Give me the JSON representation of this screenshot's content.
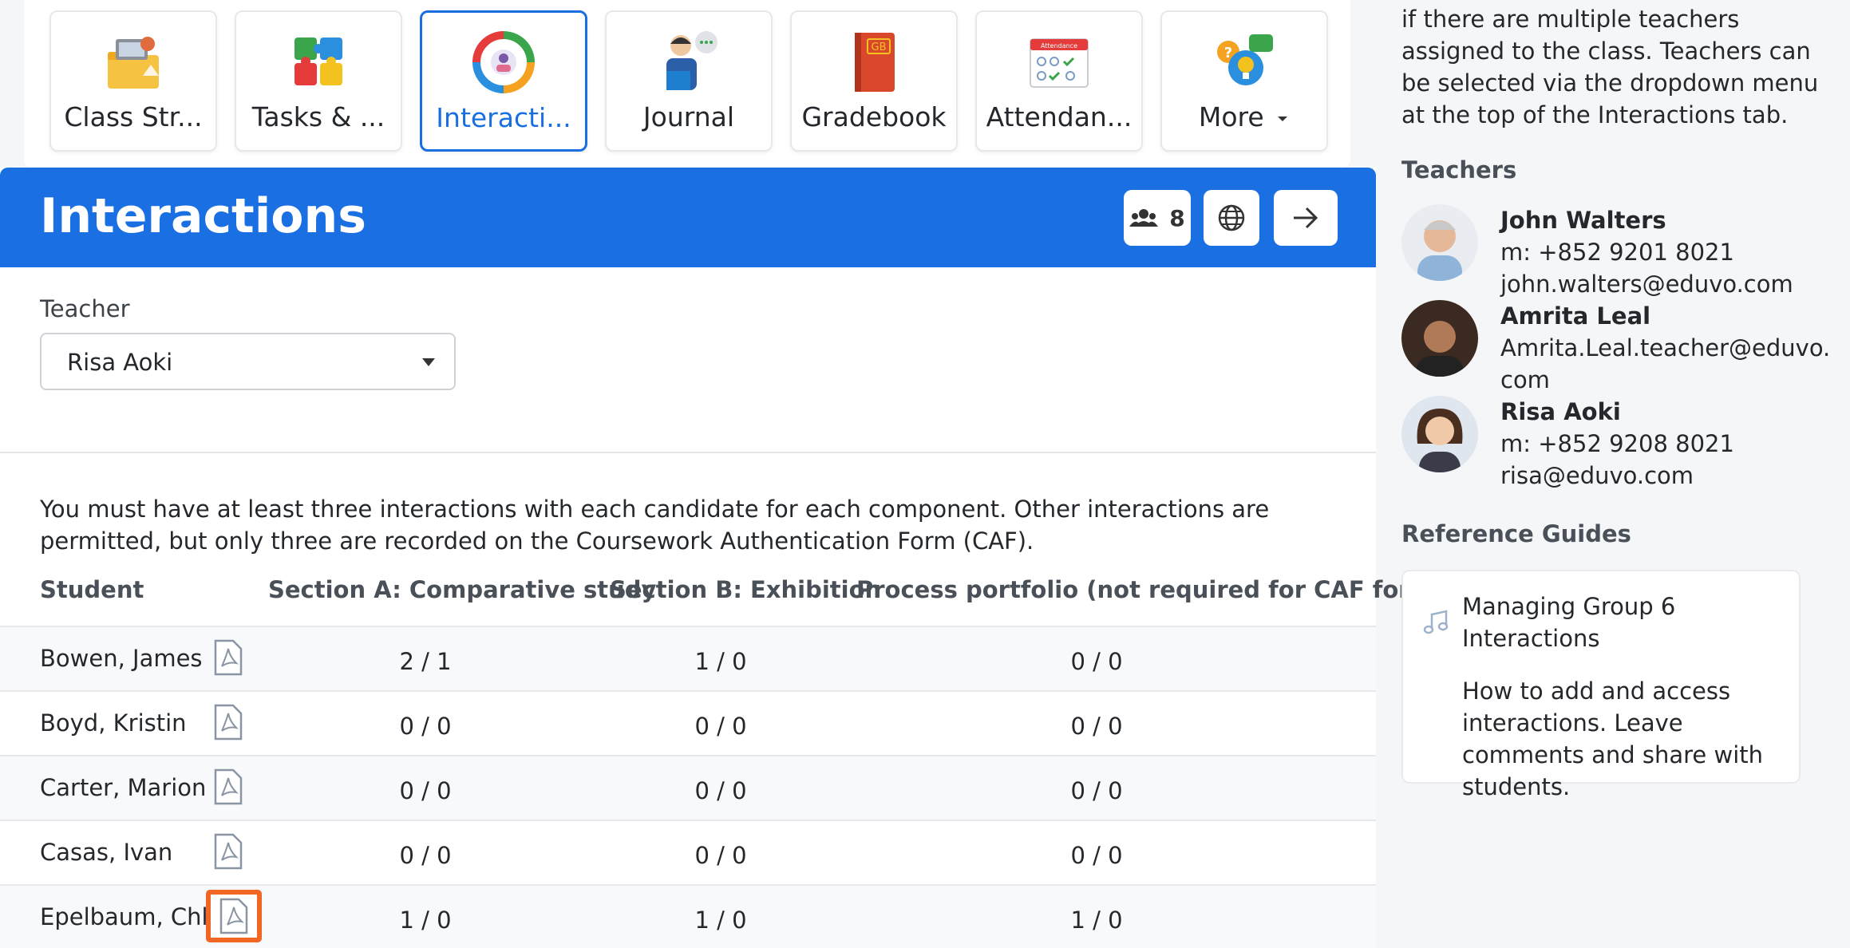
{
  "tools": [
    {
      "label": "Class Str...",
      "icon": "class-structure-icon"
    },
    {
      "label": "Tasks & ...",
      "icon": "puzzle-icon"
    },
    {
      "label": "Interacti...",
      "icon": "interactions-icon",
      "active": true
    },
    {
      "label": "Journal",
      "icon": "journal-icon"
    },
    {
      "label": "Gradebook",
      "icon": "gradebook-icon",
      "badge": "GB"
    },
    {
      "label": "Attendan...",
      "icon": "attendance-icon",
      "badge": "Attendance"
    },
    {
      "label": "More",
      "icon": "more-icon"
    }
  ],
  "header": {
    "title": "Interactions",
    "members_count": "8"
  },
  "teacher_select": {
    "label": "Teacher",
    "value": "Risa Aoki"
  },
  "notice": "You must have at least three interactions with each candidate for each component. Other interactions are permitted, but only three are recorded on the Coursework Authentication Form (CAF).",
  "table": {
    "columns": [
      "Student",
      "Section A: Comparative study",
      "Section B: Exhibition",
      "Process portfolio (not required for CAF form)"
    ],
    "rows": [
      {
        "name": "Bowen, James",
        "a": "2 / 1",
        "b": "1 / 0",
        "p": "0 / 0"
      },
      {
        "name": "Boyd, Kristin",
        "a": "0 / 0",
        "b": "0 / 0",
        "p": "0 / 0"
      },
      {
        "name": "Carter, Marion",
        "a": "0 / 0",
        "b": "0 / 0",
        "p": "0 / 0"
      },
      {
        "name": "Casas, Ivan",
        "a": "0 / 0",
        "b": "0 / 0",
        "p": "0 / 0"
      },
      {
        "name": "Epelbaum, Chloe",
        "a": "1 / 0",
        "b": "1 / 0",
        "p": "1 / 0"
      }
    ]
  },
  "sidebar": {
    "intro": "if there are multiple teachers assigned to the class. Teachers can be selected via the dropdown menu at the top of the Interactions tab.",
    "teachers_heading": "Teachers",
    "teachers": [
      {
        "name": "John Walters",
        "phone": "m: +852 9201 8021",
        "email": "john.walters@eduvo.com"
      },
      {
        "name": "Amrita Leal",
        "email_line1": "Amrita.Leal.teacher@eduvo.",
        "email_line2": "com"
      },
      {
        "name": "Risa Aoki",
        "phone": "m: +852 9208 8021",
        "email": "risa@eduvo.com"
      }
    ],
    "guides_heading": "Reference Guides",
    "guide": {
      "title": "Managing Group 6 Interactions",
      "description": "How to add and access interactions. Leave comments and share with students."
    }
  },
  "colors": {
    "accent": "#1a6fe3",
    "highlight": "#f26522"
  }
}
